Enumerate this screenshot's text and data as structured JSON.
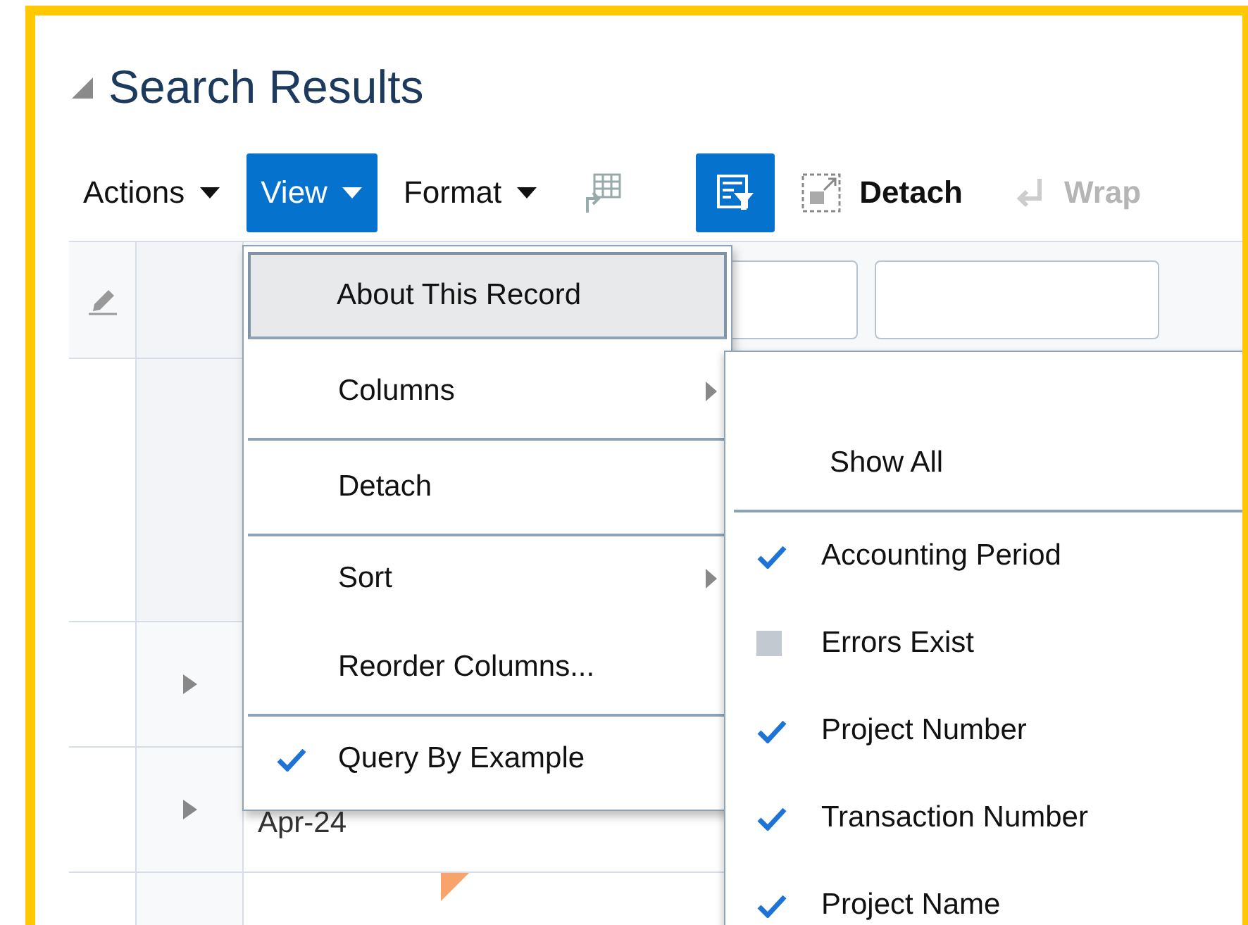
{
  "panel": {
    "title": "Search Results",
    "expanded": true
  },
  "toolbar": [
    {
      "kind": "menu",
      "label": "Actions",
      "selected": false
    },
    {
      "kind": "menu",
      "label": "View",
      "selected": true
    },
    {
      "kind": "menu",
      "label": "Format",
      "selected": false
    },
    {
      "kind": "freeze",
      "selected": false
    },
    {
      "kind": "filter",
      "selected": true
    },
    {
      "kind": "detach",
      "label": "Detach",
      "disabled": false
    },
    {
      "kind": "wrap",
      "label": "Wrap",
      "disabled": true
    }
  ],
  "table": {
    "rows": [
      {
        "column_3": "",
        "flag": false
      },
      {
        "column_3": "Apr-24",
        "flag": false
      },
      {
        "column_3": "",
        "flag": true
      }
    ]
  },
  "view_menu": {
    "items": [
      {
        "label": "About This Record",
        "selected": true,
        "checked": false,
        "submenu": false,
        "divider_after": true
      },
      {
        "label": "Columns",
        "selected": false,
        "checked": false,
        "submenu": true,
        "divider_after": true
      },
      {
        "label": "Detach",
        "selected": false,
        "checked": false,
        "submenu": false,
        "divider_after": true
      },
      {
        "label": "Sort",
        "selected": false,
        "checked": false,
        "submenu": true,
        "divider_after": false
      },
      {
        "label": "Reorder Columns...",
        "selected": false,
        "checked": false,
        "submenu": false,
        "divider_after": true
      },
      {
        "label": "Query By Example",
        "selected": false,
        "checked": true,
        "submenu": false,
        "divider_after": false
      }
    ]
  },
  "columns_menu": {
    "items": [
      {
        "label": "Show All",
        "kind": "action",
        "divider_after": true
      },
      {
        "label": "Accounting Period",
        "kind": "check",
        "checked": true,
        "divider_after": false
      },
      {
        "label": "Errors Exist",
        "kind": "check",
        "checked": false,
        "divider_after": false
      },
      {
        "label": "Project Number",
        "kind": "check",
        "checked": true,
        "divider_after": false
      },
      {
        "label": "Transaction Number",
        "kind": "check",
        "checked": true,
        "divider_after": false
      },
      {
        "label": "Project Name",
        "kind": "check",
        "checked": true,
        "divider_after": false
      }
    ]
  }
}
